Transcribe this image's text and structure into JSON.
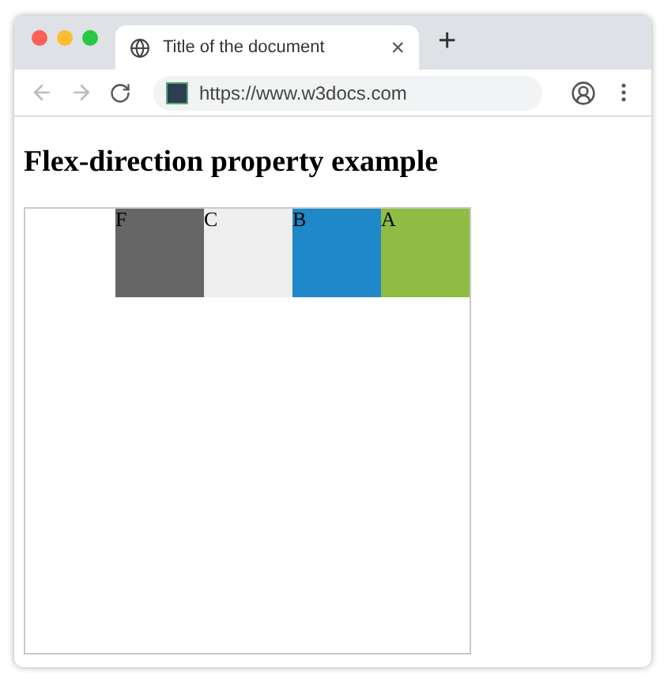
{
  "tab": {
    "title": "Title of the document",
    "close": "×"
  },
  "new_tab": "+",
  "address_bar": {
    "url": "https://www.w3docs.com"
  },
  "heading": "Flex-direction property example",
  "boxes": [
    {
      "label": "F",
      "color": "#666666"
    },
    {
      "label": "C",
      "color": "#eeeeee"
    },
    {
      "label": "B",
      "color": "#1e88c8"
    },
    {
      "label": "A",
      "color": "#8fbc42"
    }
  ]
}
